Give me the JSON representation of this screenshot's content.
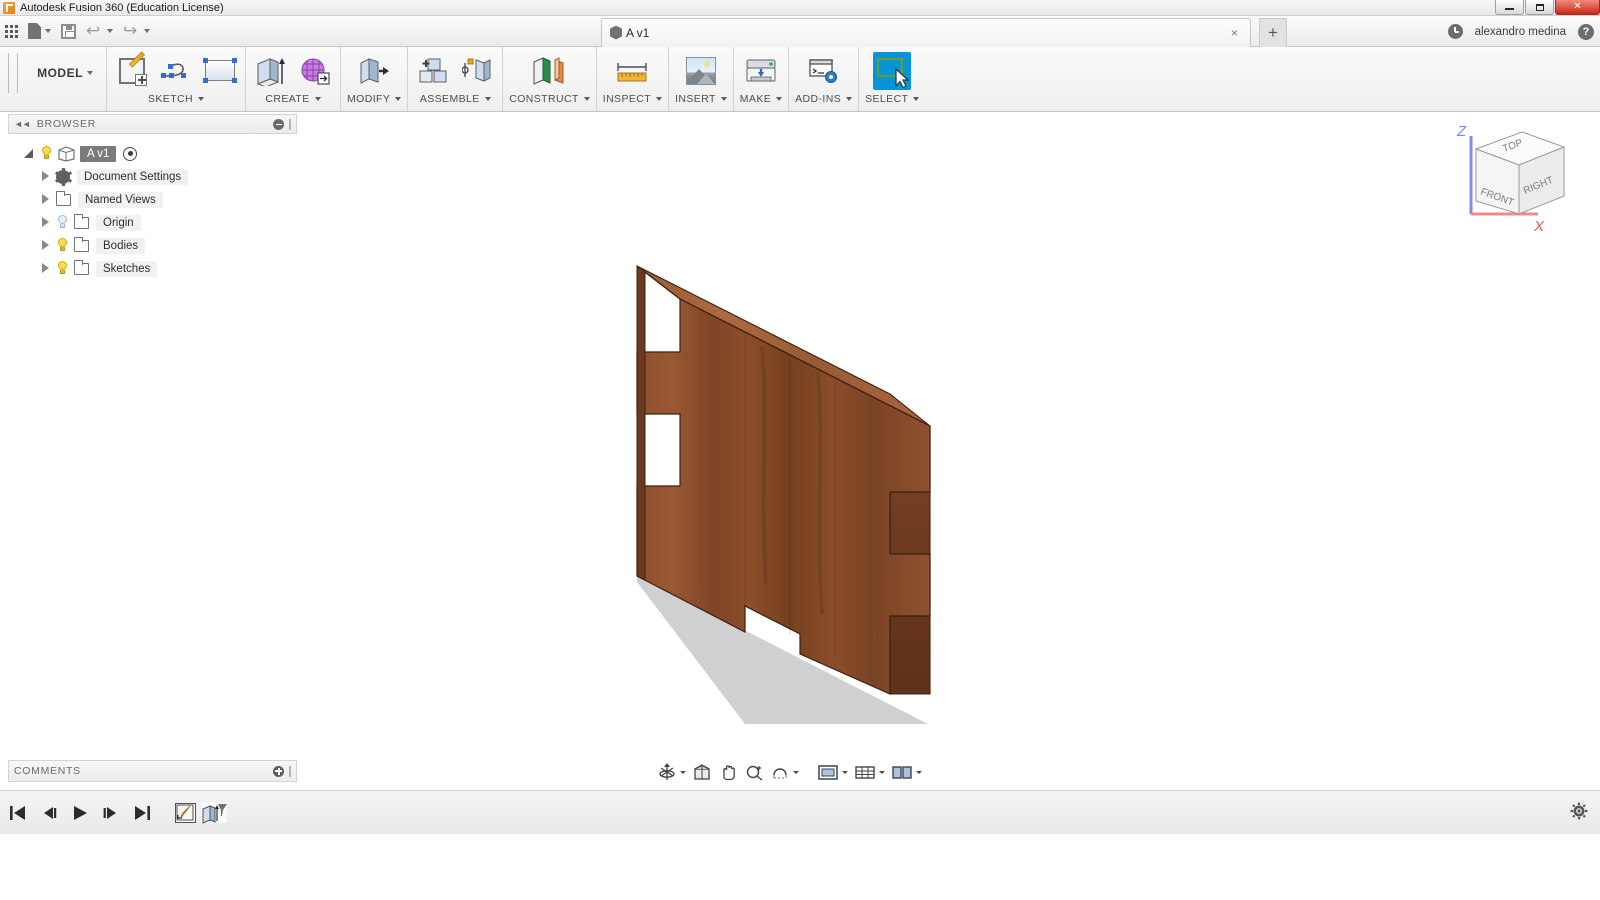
{
  "window": {
    "title": "Autodesk Fusion 360 (Education License)",
    "app_icon": "fusion-logo-icon",
    "controls": [
      {
        "name": "minimize-button",
        "label": "Minimize"
      },
      {
        "name": "restore-button",
        "label": "Restore"
      },
      {
        "name": "close-button",
        "label": "Close",
        "color": "#c9281b"
      }
    ]
  },
  "quick_access": {
    "items": [
      {
        "name": "app-grid-button",
        "icon": "grid-apps-icon",
        "label": "Show Data Panel"
      },
      {
        "name": "file-menu-button",
        "icon": "file-icon",
        "label": "File"
      },
      {
        "name": "save-button",
        "icon": "save-icon",
        "label": "Save"
      },
      {
        "name": "undo-button",
        "icon": "undo-icon",
        "label": "Undo"
      },
      {
        "name": "redo-button",
        "icon": "redo-icon",
        "label": "Redo"
      }
    ],
    "document_tab": {
      "label": "A v1",
      "icon": "component-cube-icon",
      "close_label": "×"
    },
    "new_tab_label": "+",
    "job_status_icon": "clock-icon",
    "username": "alexandro medina",
    "help_label": "?"
  },
  "ribbon": {
    "workspace": "MODEL",
    "panels": [
      {
        "name": "sketch",
        "label": "SKETCH",
        "tools": [
          {
            "name": "create-sketch-button",
            "icon": "sketch-plus-icon"
          },
          {
            "name": "spline-button",
            "icon": "spline-icon"
          },
          {
            "name": "rectangle-button",
            "icon": "rectangle-icon"
          }
        ]
      },
      {
        "name": "create",
        "label": "CREATE",
        "tools": [
          {
            "name": "extrude-button",
            "icon": "extrude-icon"
          },
          {
            "name": "create-mesh-button",
            "icon": "mesh-icon"
          }
        ]
      },
      {
        "name": "modify",
        "label": "MODIFY",
        "tools": [
          {
            "name": "press-pull-button",
            "icon": "press-pull-icon"
          }
        ]
      },
      {
        "name": "assemble",
        "label": "ASSEMBLE",
        "tools": [
          {
            "name": "new-component-button",
            "icon": "new-component-icon"
          },
          {
            "name": "joint-button",
            "icon": "joint-icon"
          }
        ]
      },
      {
        "name": "construct",
        "label": "CONSTRUCT",
        "tools": [
          {
            "name": "offset-plane-button",
            "icon": "offset-plane-icon"
          }
        ]
      },
      {
        "name": "inspect",
        "label": "INSPECT",
        "tools": [
          {
            "name": "measure-button",
            "icon": "ruler-icon"
          }
        ]
      },
      {
        "name": "insert",
        "label": "INSERT",
        "tools": [
          {
            "name": "insert-canvas-button",
            "icon": "image-icon"
          }
        ]
      },
      {
        "name": "make",
        "label": "MAKE",
        "tools": [
          {
            "name": "3d-print-button",
            "icon": "printer-icon"
          }
        ]
      },
      {
        "name": "add-ins",
        "label": "ADD-INS",
        "tools": [
          {
            "name": "scripts-addins-button",
            "icon": "console-gear-icon"
          }
        ]
      },
      {
        "name": "select",
        "label": "SELECT",
        "active": true,
        "accent": "#0696d7",
        "tools": [
          {
            "name": "select-tool-button",
            "icon": "select-cursor-icon"
          }
        ]
      }
    ]
  },
  "browser": {
    "title": "BROWSER",
    "collapse_icon": "collapse-left-icon",
    "minimize_icon": "minimize-panel-icon",
    "tree": [
      {
        "name": "browser-root-component",
        "label": "A v1",
        "icon": "component-cube-icon",
        "expand": "open",
        "light": "on",
        "selected": true,
        "trailing_icon": "activate-component-icon",
        "level": 0
      },
      {
        "name": "browser-item-document-settings",
        "label": "Document Settings",
        "icon": "gear-icon",
        "expand": "closed",
        "light": "none",
        "level": 1
      },
      {
        "name": "browser-item-named-views",
        "label": "Named Views",
        "icon": "folder-icon",
        "expand": "closed",
        "light": "none",
        "level": 1
      },
      {
        "name": "browser-item-origin",
        "label": "Origin",
        "icon": "folder-icon",
        "expand": "closed",
        "light": "off",
        "level": 1
      },
      {
        "name": "browser-item-bodies",
        "label": "Bodies",
        "icon": "folder-icon",
        "expand": "closed",
        "light": "on",
        "level": 1
      },
      {
        "name": "browser-item-sketches",
        "label": "Sketches",
        "icon": "folder-icon",
        "expand": "closed",
        "light": "on",
        "level": 1
      }
    ]
  },
  "canvas": {
    "background": "#ffffff",
    "model": {
      "name": "wood-panel-body",
      "description": "Brown wooden panel with finger-joint notches on left and right edges",
      "face_color": "#8a4b2a",
      "top_edge_color": "#a0603a",
      "side_edge_color": "#6e3a1f",
      "shadow_color": "#c9c9c9"
    },
    "viewcube": {
      "name": "view-cube",
      "faces": {
        "top": "TOP",
        "front": "FRONT",
        "right": "RIGHT"
      },
      "axes": [
        {
          "label": "Z",
          "color": "#5b6ff5"
        },
        {
          "label": "X",
          "color": "#f05a5a"
        }
      ]
    }
  },
  "comments": {
    "title": "COMMENTS",
    "add_icon": "add-comment-icon"
  },
  "view_nav": {
    "items": [
      {
        "name": "orbit-button",
        "icon": "orbit-icon",
        "has_caret": true
      },
      {
        "name": "look-at-button",
        "icon": "look-at-icon",
        "has_caret": false
      },
      {
        "name": "pan-button",
        "icon": "pan-hand-icon",
        "has_caret": false
      },
      {
        "name": "zoom-button",
        "icon": "zoom-icon",
        "has_caret": false
      },
      {
        "name": "fit-button",
        "icon": "fit-view-icon",
        "has_caret": true
      },
      {
        "name": "display-settings-button",
        "icon": "display-settings-icon",
        "has_caret": true
      },
      {
        "name": "grid-snaps-button",
        "icon": "grid-icon",
        "has_caret": true
      },
      {
        "name": "viewports-button",
        "icon": "viewports-icon",
        "has_caret": true
      }
    ]
  },
  "timeline": {
    "controls": [
      {
        "name": "timeline-go-to-beginning-button",
        "icon": "skip-start-icon"
      },
      {
        "name": "timeline-step-back-button",
        "icon": "step-back-icon"
      },
      {
        "name": "timeline-play-button",
        "icon": "play-icon"
      },
      {
        "name": "timeline-step-forward-button",
        "icon": "step-forward-icon"
      },
      {
        "name": "timeline-go-to-end-button",
        "icon": "skip-end-icon"
      }
    ],
    "features": [
      {
        "name": "timeline-feature-sketch",
        "icon": "sketch-feature-icon",
        "label": "Sketch"
      },
      {
        "name": "timeline-feature-extrude",
        "icon": "extrude-feature-icon",
        "label": "Extrude"
      }
    ],
    "marker_icon": "timeline-end-marker-icon",
    "settings_icon": "gear-icon"
  }
}
